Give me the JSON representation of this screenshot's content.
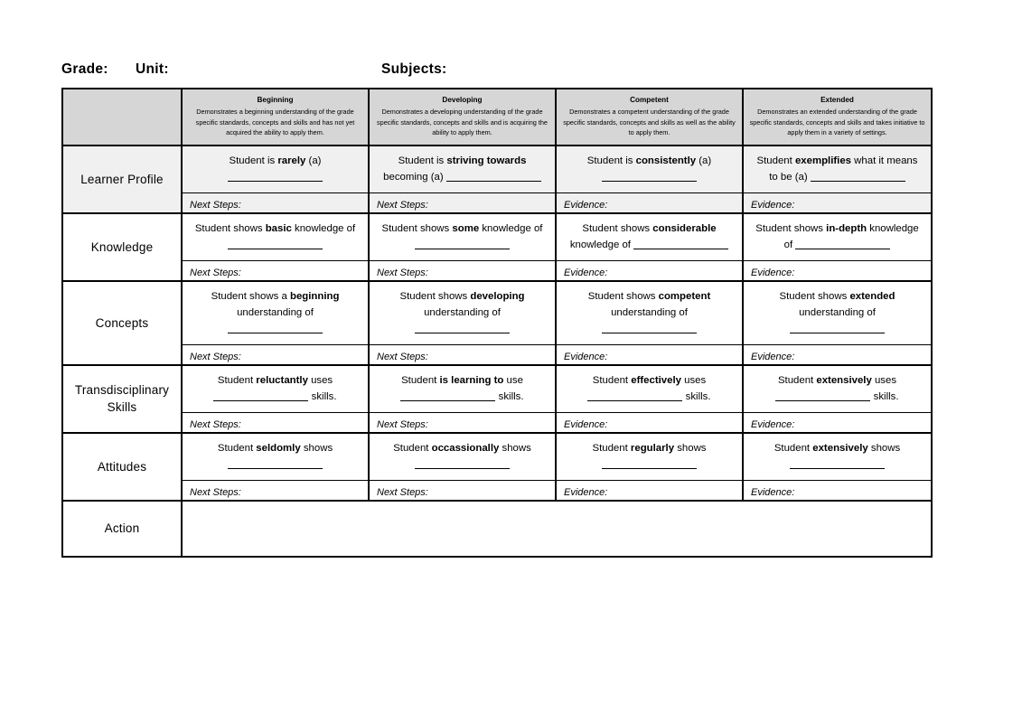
{
  "document": {
    "header": {
      "grade_label": "Grade:",
      "unit_label": "Unit:",
      "subjects_label": "Subjects:"
    }
  },
  "table": {
    "corner_label": "",
    "bands": [
      {
        "title": "Beginning",
        "description": "Demonstrates a beginning understanding of the grade specific standards, concepts and skills and has not yet acquired the ability to apply them."
      },
      {
        "title": "Developing",
        "description": "Demonstrates a developing understanding of the grade specific standards, concepts and skills and is acquiring the ability to apply them."
      },
      {
        "title": "Competent",
        "description": "Demonstrates a competent understanding of the grade specific standards, concepts and skills as well as the ability to apply them."
      },
      {
        "title": "Extended",
        "description": "Demonstrates an extended understanding of the grade specific standards, concepts and skills and takes initiative to apply them in a variety of settings."
      }
    ],
    "notes_labels": {
      "next_steps": "Next Steps:",
      "evidence": "Evidence:"
    },
    "rows": [
      {
        "label": "Learner Profile",
        "shaded": true,
        "cells": [
          {
            "pre": "Student is ",
            "strong": "rarely",
            "post": " (a)",
            "blank_after": true,
            "notes": "Next Steps:"
          },
          {
            "pre": "Student is ",
            "strong": "striving towards",
            "post": " becoming (a)",
            "blank_after": true,
            "notes": "Next Steps:"
          },
          {
            "pre": "Student is ",
            "strong": "consistently",
            "post": " (a)",
            "blank_after": true,
            "notes": "Evidence:"
          },
          {
            "pre": "Student ",
            "strong": "exemplifies",
            "post": " what it means to be (a)",
            "blank_after": true,
            "notes": "Evidence:"
          }
        ]
      },
      {
        "label": "Knowledge",
        "shaded": false,
        "cells": [
          {
            "pre": "Student shows ",
            "strong": "basic",
            "post": " knowledge of",
            "blank_after": true,
            "notes": "Next Steps:"
          },
          {
            "pre": "Student shows ",
            "strong": "some",
            "post": " knowledge of",
            "blank_after": true,
            "notes": "Next Steps:"
          },
          {
            "pre": "Student shows ",
            "strong": "considerable",
            "post": " knowledge of",
            "blank_after": true,
            "notes": "Evidence:"
          },
          {
            "pre": "Student shows ",
            "strong": "in-depth",
            "post": " knowledge of",
            "blank_after": true,
            "notes": "Evidence:"
          }
        ]
      },
      {
        "label": "Concepts",
        "shaded": false,
        "cells": [
          {
            "pre": "Student shows a ",
            "strong": "beginning",
            "post": " understanding of",
            "blank_after": true,
            "notes": "Next Steps:"
          },
          {
            "pre": "Student shows ",
            "strong": "developing",
            "post": " understanding of",
            "blank_after": true,
            "notes": "Next Steps:"
          },
          {
            "pre": "Student shows ",
            "strong": "competent",
            "post": " understanding of",
            "blank_after": true,
            "notes": "Evidence:"
          },
          {
            "pre": "Student shows ",
            "strong": "extended",
            "post": " understanding of",
            "blank_after": true,
            "notes": "Evidence:"
          }
        ]
      },
      {
        "label": "Transdisciplinary Skills",
        "shaded": false,
        "cells": [
          {
            "pre": "Student ",
            "strong": "reluctantly",
            "post": " uses",
            "blank_after": true,
            "tail": " skills.",
            "notes": "Next Steps:"
          },
          {
            "pre": "Student ",
            "strong": "is learning to",
            "post": " use",
            "blank_after": true,
            "tail": " skills.",
            "notes": "Next Steps:"
          },
          {
            "pre": "Student ",
            "strong": "effectively",
            "post": " uses",
            "blank_after": true,
            "tail": " skills.",
            "notes": "Evidence:"
          },
          {
            "pre": "Student ",
            "strong": "extensively",
            "post": " uses",
            "blank_after": true,
            "tail": " skills.",
            "notes": "Evidence:"
          }
        ]
      },
      {
        "label": "Attitudes",
        "shaded": false,
        "cells": [
          {
            "pre": "Student ",
            "strong": "seldomly",
            "post": " shows",
            "blank_after": true,
            "notes": "Next Steps:"
          },
          {
            "pre": "Student ",
            "strong": "occassionally",
            "post": " shows",
            "blank_after": true,
            "notes": "Next Steps:"
          },
          {
            "pre": "Student ",
            "strong": "regularly",
            "post": " shows",
            "blank_after": true,
            "notes": "Evidence:"
          },
          {
            "pre": "Student ",
            "strong": "extensively",
            "post": " shows",
            "blank_after": true,
            "notes": "Evidence:"
          }
        ]
      }
    ],
    "action_row": {
      "label": "Action",
      "content": ""
    }
  }
}
